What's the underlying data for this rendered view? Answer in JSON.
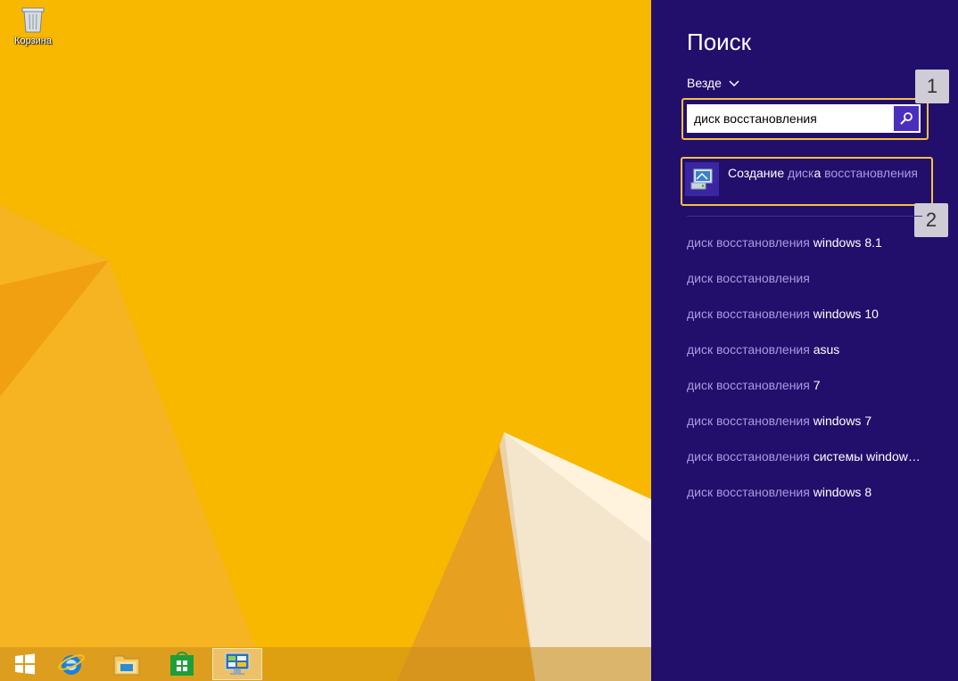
{
  "desktop": {
    "recycle_bin_label": "Корзина"
  },
  "taskbar": {
    "items": [
      {
        "name": "start-button",
        "icon": "windows-logo-icon"
      },
      {
        "name": "internet-explorer",
        "icon": "ie-icon"
      },
      {
        "name": "file-explorer",
        "icon": "folder-icon"
      },
      {
        "name": "store",
        "icon": "store-icon"
      },
      {
        "name": "control-panel",
        "icon": "control-panel-icon",
        "active": true
      }
    ]
  },
  "search_pane": {
    "title": "Поиск",
    "scope": "Везде",
    "query": "диск восстановления",
    "result": {
      "parts": [
        "Создание ",
        "диск",
        "а ",
        "восстановления"
      ]
    },
    "suggestions": [
      {
        "query": "диск восстановления",
        "completion": " windows 8.1"
      },
      {
        "query": "диск восстановления",
        "completion": ""
      },
      {
        "query": "диск восстановления",
        "completion": " windows 10"
      },
      {
        "query": "диск восстановления",
        "completion": " asus"
      },
      {
        "query": "диск восстановления",
        "completion": " 7"
      },
      {
        "query": "диск восстановления",
        "completion": " windows 7"
      },
      {
        "query": "диск восстановления",
        "completion": " системы window…"
      },
      {
        "query": "диск восстановления",
        "completion": " windows 8"
      }
    ]
  },
  "callouts": [
    "1",
    "2"
  ],
  "colors": {
    "charm_background": "#220F6C",
    "highlight_border": "#F5C242",
    "search_button": "#4A2FBF",
    "desktop_background": "#F8B800"
  }
}
